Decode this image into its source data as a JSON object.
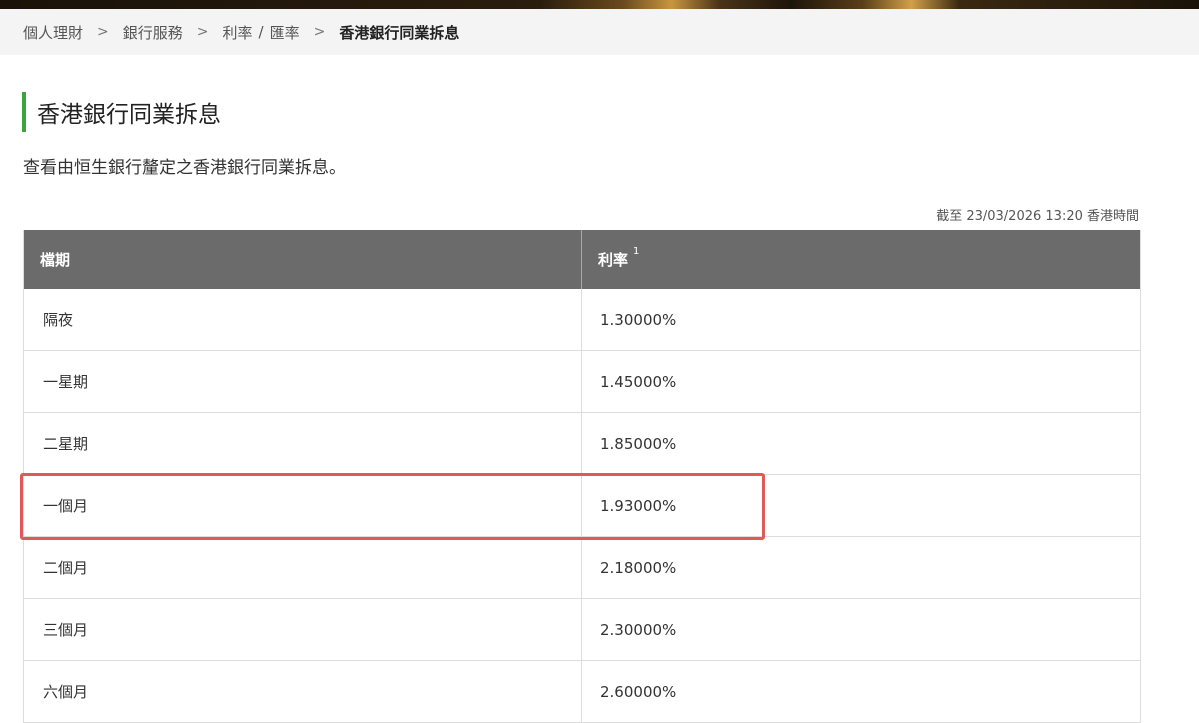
{
  "breadcrumb": {
    "items": [
      "個人理財",
      "銀行服務",
      "利率",
      "匯率",
      "香港銀行同業拆息"
    ],
    "separator": ">",
    "slash": "/"
  },
  "page": {
    "title": "香港銀行同業拆息",
    "description": "查看由恒生銀行釐定之香港銀行同業拆息。",
    "as_of": "截至 23/03/2026 13:20 香港時間",
    "accent_color": "#3aa53a",
    "highlight_color": "#e05a5a"
  },
  "table": {
    "headers": [
      "檔期",
      "利率"
    ],
    "rate_footnote": "1",
    "rows": [
      {
        "term": "隔夜",
        "rate": "1.30000%"
      },
      {
        "term": "一星期",
        "rate": "1.45000%"
      },
      {
        "term": "二星期",
        "rate": "1.85000%"
      },
      {
        "term": "一個月",
        "rate": "1.93000%"
      },
      {
        "term": "二個月",
        "rate": "2.18000%"
      },
      {
        "term": "三個月",
        "rate": "2.30000%"
      },
      {
        "term": "六個月",
        "rate": "2.60000%"
      }
    ]
  }
}
